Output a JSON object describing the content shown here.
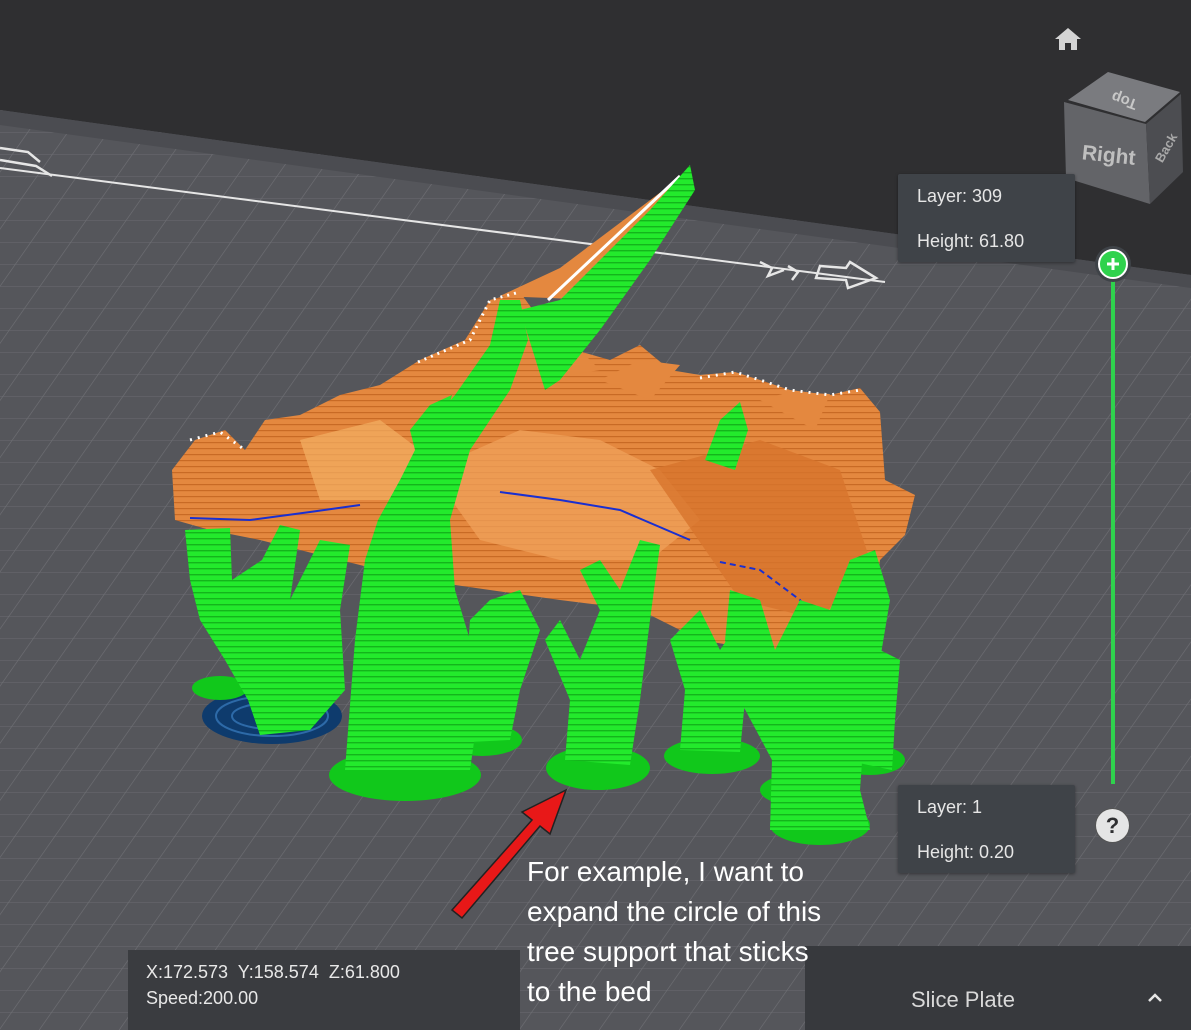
{
  "nav_cube": {
    "top_face": "Top",
    "front_face": "Right",
    "side_face": "Back"
  },
  "layer_slider": {
    "top": {
      "layer": "Layer: 309",
      "height": "Height: 61.80"
    },
    "bottom": {
      "layer": "Layer: 1",
      "height": "Height: 0.20"
    },
    "handle_icon": "plus-icon"
  },
  "help_label": "?",
  "status": {
    "coords": "X:172.573  Y:158.574  Z:61.800",
    "speed": "Speed:200.00"
  },
  "slice_panel": {
    "label": "Slice Plate",
    "icon": "chevron-up-icon"
  },
  "annotation": {
    "text": "For example, I want to\nexpand the circle of this\ntree support that sticks\nto the bed",
    "arrow_color": "#e81818"
  },
  "colors": {
    "support": "#1fe82a",
    "model": "#e0843f",
    "bed": "#5b5c61",
    "slider": "#2fd24d"
  }
}
